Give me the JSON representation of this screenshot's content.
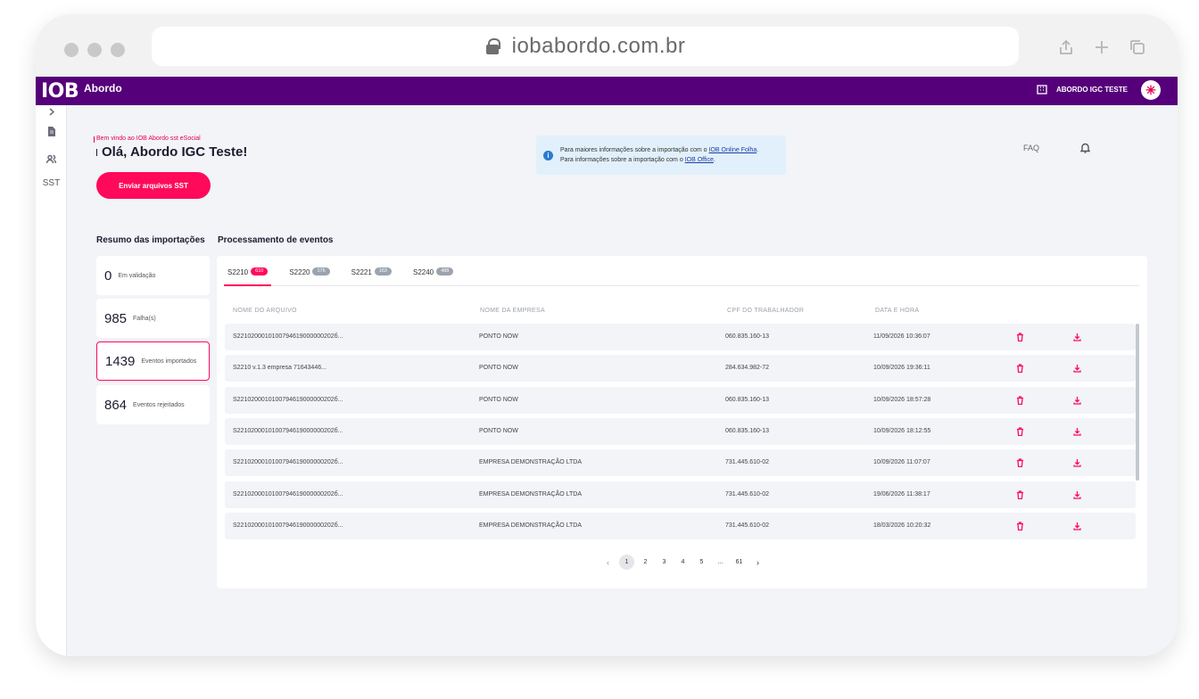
{
  "browser": {
    "url": "iobabordo.com.br"
  },
  "app": {
    "logo": "IOB",
    "product": "Abordo",
    "company_name": "ABORDO IGC TESTE",
    "avatar_glyph": "✳"
  },
  "sidebar": {
    "sst_label": "SST"
  },
  "header": {
    "welcome": "Bem vindo ao IOB Abordo sst eSocial",
    "greeting": "Olá, Abordo IGC Teste!",
    "send_button": "Enviar arquivos SST",
    "info_line1_prefix": "Para maiores informações sobre a importação com o ",
    "info_line1_link": "IOB Online Folha",
    "info_line1_suffix": ".",
    "info_line2_prefix": "Para informações sobre a importação com o ",
    "info_line2_link": "IOB Office",
    "info_line2_suffix": ".",
    "faq": "FAQ"
  },
  "summary": {
    "title": "Resumo das importações",
    "cards": [
      {
        "value": "0",
        "label": "Em validação"
      },
      {
        "value": "985",
        "label": "Falha(s)"
      },
      {
        "value": "1439",
        "label": "Eventos importados"
      },
      {
        "value": "864",
        "label": "Eventos rejeitados"
      }
    ]
  },
  "events": {
    "title": "Processamento de eventos",
    "tabs": [
      {
        "label": "S2210",
        "count": "610"
      },
      {
        "label": "S2220",
        "count": "176"
      },
      {
        "label": "S2221",
        "count": "163"
      },
      {
        "label": "S2240",
        "count": "488"
      }
    ],
    "columns": [
      "NOME DO ARQUIVO",
      "NOME DA EMPRESA",
      "CPF DO TRABALHADOR",
      "DATA E HORA"
    ],
    "rows": [
      {
        "file": "S2210200010100794619000000202б...",
        "company": "PONTO NOW",
        "cpf": "060.835.160-13",
        "date": "11/09/2026 10:36:07"
      },
      {
        "file": "S2210 v.1.3 empresa 71643446...",
        "company": "PONTO NOW",
        "cpf": "284.634.982-72",
        "date": "10/09/2026 19:36:11"
      },
      {
        "file": "S2210200010100794619000000202б...",
        "company": "PONTO NOW",
        "cpf": "060.835.160-13",
        "date": "10/09/2026 18:57:28"
      },
      {
        "file": "S2210200010100794619000000202б...",
        "company": "PONTO NOW",
        "cpf": "060.835.160-13",
        "date": "10/09/2026 18:12:55"
      },
      {
        "file": "S2210200010100794619000000202б...",
        "company": "EMPRESA DEMONSTRAÇÃO LTDA",
        "cpf": "731.445.610-02",
        "date": "10/09/2026 11:07:07"
      },
      {
        "file": "S2210200010100794619000000202б...",
        "company": "EMPRESA DEMONSTRAÇÃO LTDA",
        "cpf": "731.445.610-02",
        "date": "19/06/2026 11:38:17"
      },
      {
        "file": "S2210200010100794619000000202б...",
        "company": "EMPRESA DEMONSTRAÇÃO LTDA",
        "cpf": "731.445.610-02",
        "date": "18/03/2026 10:20:32"
      }
    ],
    "pagination": {
      "prev": "‹",
      "pages": [
        "1",
        "2",
        "3",
        "4",
        "5",
        "...",
        "61"
      ],
      "current": "1",
      "next": "›"
    }
  },
  "colors": {
    "brand_purple": "#55007a",
    "accent_pink": "#ff0a5a"
  }
}
